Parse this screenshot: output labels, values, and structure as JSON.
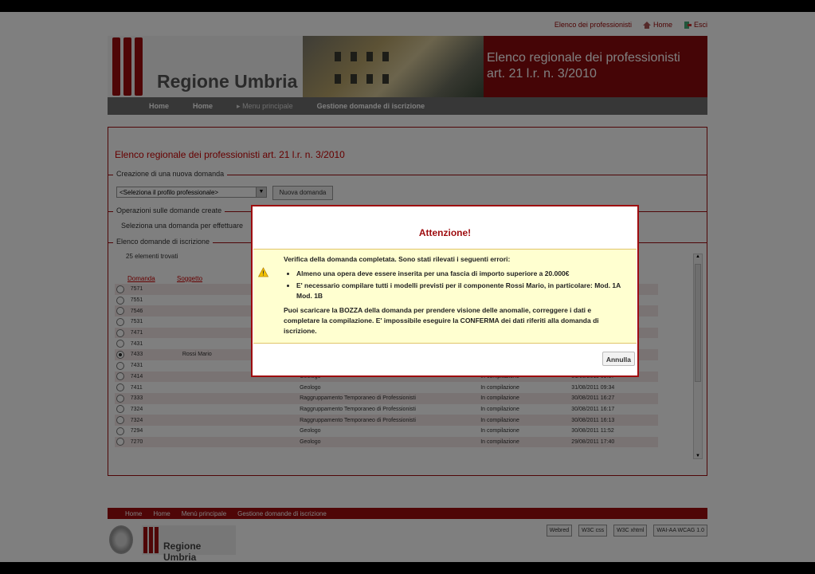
{
  "toplinks": {
    "area_riservata": "Elenco dei professionisti",
    "home": "Home",
    "esci": "Esci"
  },
  "banner": {
    "logo_text": "Regione Umbria",
    "title_line1": "Elenco regionale dei professionisti",
    "title_line2": "art. 21 l.r. n. 3/2010"
  },
  "nav": {
    "items": [
      "Home",
      "Home",
      "Menu principale",
      "Gestione domande di iscrizione"
    ]
  },
  "main": {
    "title": "Elenco regionale dei professionisti art. 21 l.r. n. 3/2010",
    "section1": "Creazione di una nuova domanda",
    "select_value": "<Seleziona il profilo professionale>",
    "new_button": "Nuova domanda",
    "section2": "Operazioni sulle domande create",
    "select_hint": "Seleziona una domanda per effettuare",
    "section3": "Elenco domande di iscrizione",
    "count": "25 elementi trovati",
    "col_domanda": "Domanda",
    "col_soggetto": "Soggetto",
    "rows": [
      [
        "7571",
        "",
        "",
        "",
        ""
      ],
      [
        "7551",
        "",
        "",
        "",
        ""
      ],
      [
        "7546",
        "",
        "",
        "",
        ""
      ],
      [
        "7531",
        "",
        "",
        "",
        ""
      ],
      [
        "7471",
        "",
        "",
        "",
        ""
      ],
      [
        "7431",
        "",
        "",
        "",
        ""
      ],
      [
        "7433",
        "Rossi Mario",
        "",
        "",
        ""
      ],
      [
        "7431",
        "",
        "",
        "",
        ""
      ],
      [
        "7414",
        "",
        "Geologo",
        "In compilazione",
        "31/08/2011 09:37"
      ],
      [
        "7411",
        "",
        "Geologo",
        "In compilazione",
        "31/08/2011 09:34"
      ],
      [
        "7333",
        "",
        "Raggruppamento Temporaneo di Professionisti",
        "In compilazione",
        "30/08/2011 16:27"
      ],
      [
        "7324",
        "",
        "Raggruppamento Temporaneo di Professionisti",
        "In compilazione",
        "30/08/2011 16:17"
      ],
      [
        "7324",
        "",
        "Raggruppamento Temporaneo di Professionisti",
        "In compilazione",
        "30/08/2011 16:13"
      ],
      [
        "7294",
        "",
        "Geologo",
        "In compilazione",
        "30/08/2011 11:52"
      ],
      [
        "7270",
        "",
        "Geologo",
        "In compilazione",
        "29/08/2011 17:40"
      ]
    ],
    "selected_row": 6
  },
  "footer": {
    "nav": [
      "Home",
      "Home",
      "Menù principale",
      "Gestione domande di iscrizione"
    ],
    "logo_text": "Regione Umbria",
    "badges": [
      "Webred",
      "W3C css",
      "W3C xhtml",
      "WAI-AA WCAG 1.0"
    ]
  },
  "modal": {
    "title": "Attenzione!",
    "intro": "Verifica della domanda completata. Sono stati rilevati i seguenti errori:",
    "errors": [
      "Almeno una opera deve essere inserita per una fascia di importo superiore a 20.000€",
      "E' necessario compilare tutti i modelli previsti per il componente Rossi Mario, in particolare: Mod. 1A Mod. 1B"
    ],
    "note": "Puoi scaricare la BOZZA della domanda per prendere visione delle anomalie, correggere i dati e completare la compilazione. E' impossibile eseguire la CONFERMA dei dati riferiti alla domanda di iscrizione.",
    "cancel": "Annulla"
  },
  "colors": {
    "accent": "#9e0c0f",
    "warning_bg": "#ffffd0"
  }
}
